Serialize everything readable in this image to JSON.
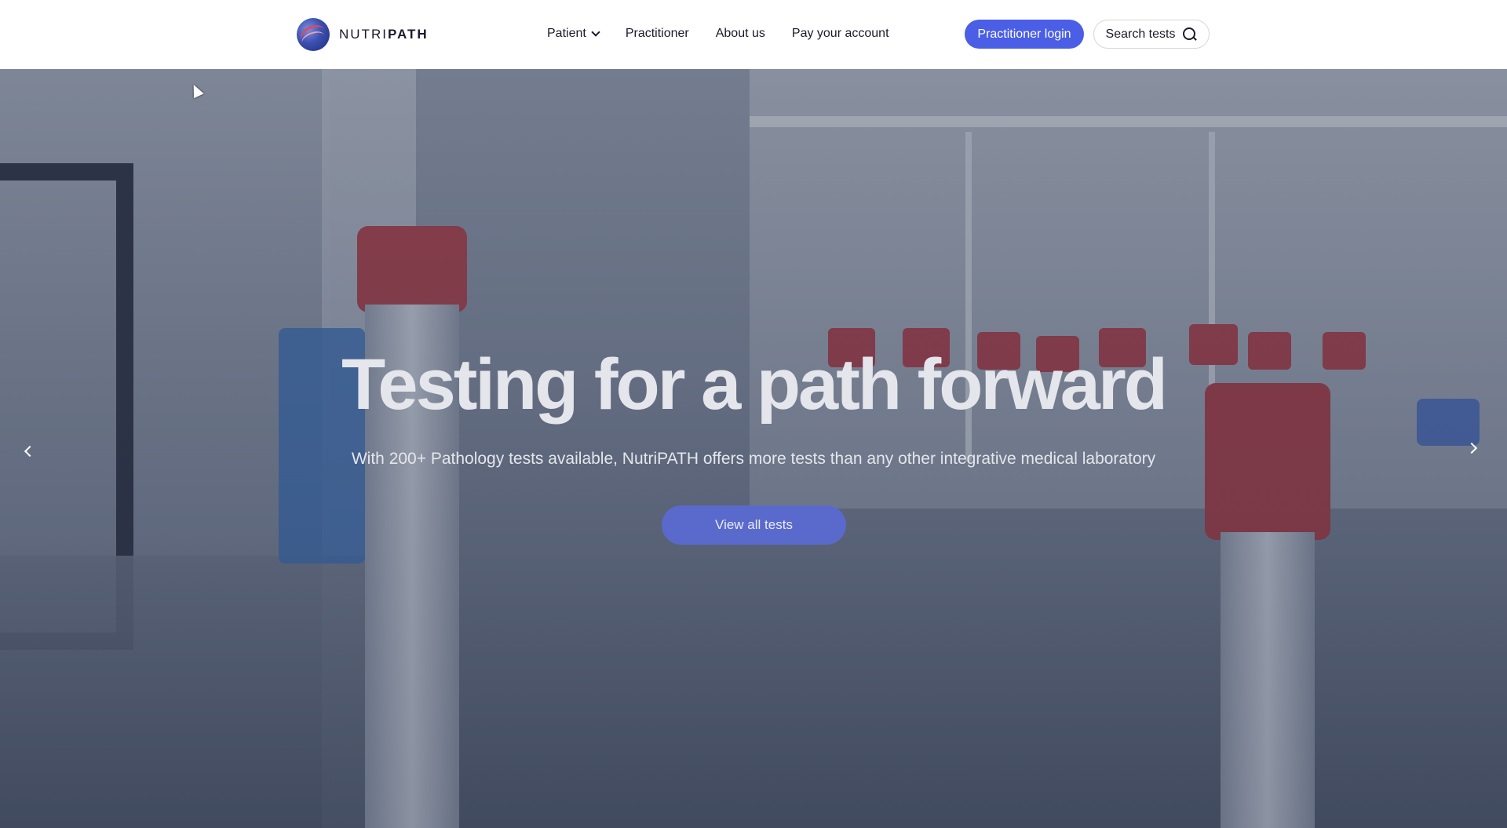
{
  "brand": {
    "name_light": "NUTRI",
    "name_bold": "PATH",
    "logo_icon": "nutripath-globe-icon"
  },
  "nav": {
    "items": [
      {
        "label": "Patient",
        "has_dropdown": true
      },
      {
        "label": "Practitioner"
      },
      {
        "label": "About us"
      },
      {
        "label": "Pay your account"
      }
    ]
  },
  "actions": {
    "login_label": "Practitioner login",
    "search_label": "Search tests",
    "search_icon": "search-icon"
  },
  "hero": {
    "title": "Testing for a path forward",
    "subtitle": "With 200+ Pathology tests available, NutriPATH offers more tests than any other integrative medical laboratory",
    "cta_label": "View all tests",
    "prev_icon": "chevron-left-icon",
    "next_icon": "chevron-right-icon"
  },
  "colors": {
    "accent": "#4a5ee6",
    "cta": "#5a6acc",
    "text_dark": "#1a1a2e",
    "hero_text": "#e4e6ec"
  }
}
